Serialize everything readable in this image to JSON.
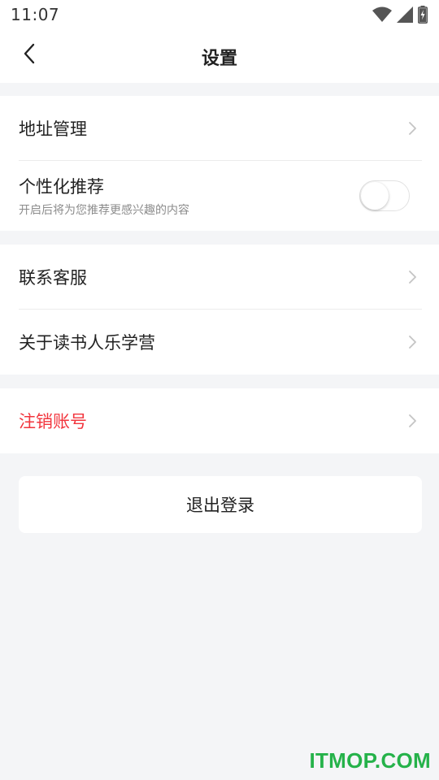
{
  "status_bar": {
    "time": "11:07",
    "icons": [
      "wifi-icon",
      "cellular-signal-icon",
      "battery-charging-icon"
    ]
  },
  "nav": {
    "title": "设置",
    "back_icon": "chevron-left-icon"
  },
  "groups": [
    {
      "items": [
        {
          "label": "地址管理",
          "type": "link"
        },
        {
          "label": "个性化推荐",
          "subtitle": "开启后将为您推荐更感兴趣的内容",
          "type": "toggle",
          "toggle_on": false
        }
      ]
    },
    {
      "items": [
        {
          "label": "联系客服",
          "type": "link"
        },
        {
          "label": "关于读书人乐学营",
          "type": "link"
        }
      ]
    },
    {
      "items": [
        {
          "label": "注销账号",
          "type": "link",
          "danger": true
        }
      ]
    }
  ],
  "logout_label": "退出登录",
  "watermark": "ITMOP.COM",
  "colors": {
    "background": "#f4f5f7",
    "surface": "#ffffff",
    "danger": "#f2353d",
    "subtitle": "#8c8c8c",
    "watermark": "#25b24a"
  }
}
